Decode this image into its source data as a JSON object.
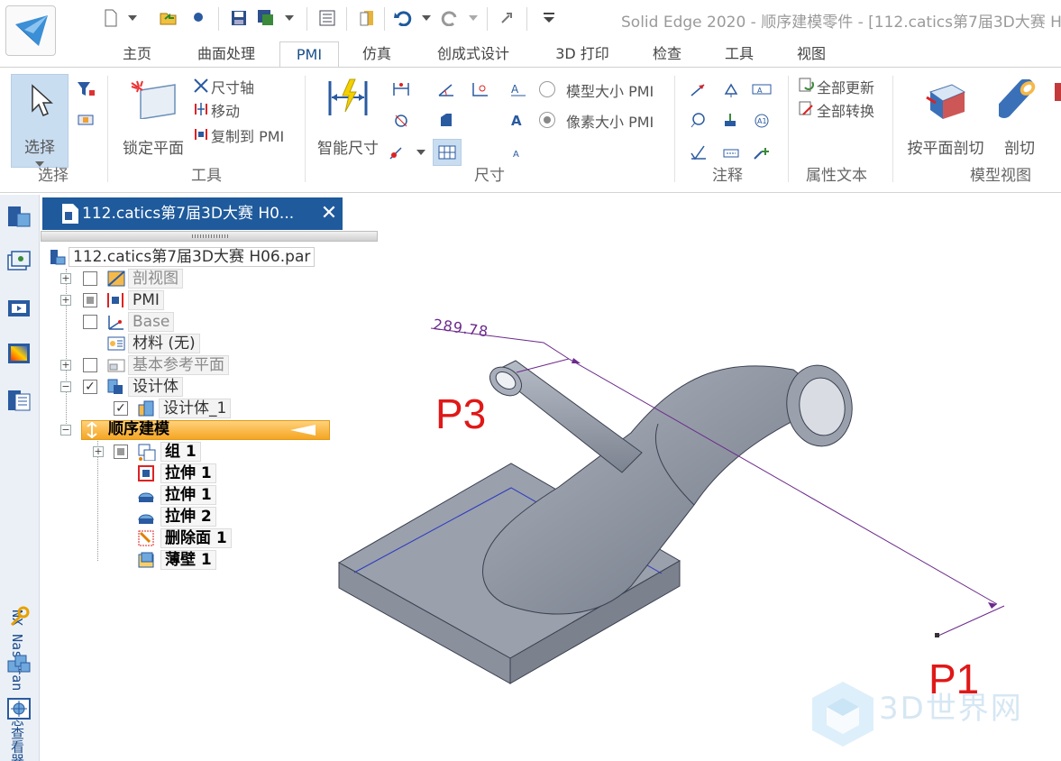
{
  "window": {
    "title": "Solid Edge 2020 - 顺序建模零件 - [112.catics第7届3D大赛 H"
  },
  "ribbon": {
    "tabs": [
      {
        "label": "主页"
      },
      {
        "label": "曲面处理"
      },
      {
        "label": "PMI"
      },
      {
        "label": "仿真"
      },
      {
        "label": "创成式设计"
      },
      {
        "label": "3D 打印"
      },
      {
        "label": "检查"
      },
      {
        "label": "工具"
      },
      {
        "label": "视图"
      }
    ],
    "active_tab": "PMI",
    "select_group": {
      "button": "选择",
      "label": "选择"
    },
    "tools_group": {
      "lock_plane": "锁定平面",
      "dimension_axis": "尺寸轴",
      "move": "移动",
      "copy_to_pmi": "复制到 PMI",
      "label": "工具"
    },
    "dimension_group": {
      "smart_dimension": "智能尺寸",
      "model_size": "模型大小 PMI",
      "pixel_size": "像素大小 PMI",
      "selected_size": "pixel",
      "label": "尺寸"
    },
    "annotation_group": {
      "label": "注释"
    },
    "attribute_text_group": {
      "update_all": "全部更新",
      "convert_all": "全部转换",
      "label": "属性文本"
    },
    "model_view_group": {
      "section_by_plane": "按平面剖切",
      "section": "剖切",
      "label": "模型视图"
    }
  },
  "sidebar": {
    "vertical_label": "NX Nastran 日志查看器"
  },
  "document": {
    "tab_title": "112.catics第7届3D大赛 H0...",
    "close_glyph": "✕"
  },
  "tree": {
    "root": "112.catics第7届3D大赛 H06.par",
    "items": [
      {
        "label": "剖视图"
      },
      {
        "label": "PMI"
      },
      {
        "label": "Base"
      },
      {
        "label": "材料 (无)"
      },
      {
        "label": "基本参考平面"
      },
      {
        "label": "设计体"
      },
      {
        "label": "设计体_1"
      },
      {
        "label": "顺序建模"
      },
      {
        "label": "组 1"
      },
      {
        "label": "拉伸 1"
      },
      {
        "label": "拉伸 1"
      },
      {
        "label": "拉伸 2"
      },
      {
        "label": "删除面 1"
      },
      {
        "label": "薄壁 1"
      }
    ]
  },
  "viewport": {
    "dimension_value": "289.78",
    "annotations": [
      "P3",
      "P1"
    ],
    "watermark_text": "3D世界网"
  },
  "colors": {
    "accent": "#1e5a9c",
    "annotation_red": "#e01818",
    "dimension_purple": "#6c2a8c",
    "sequential_bar": "#f5b94a"
  }
}
